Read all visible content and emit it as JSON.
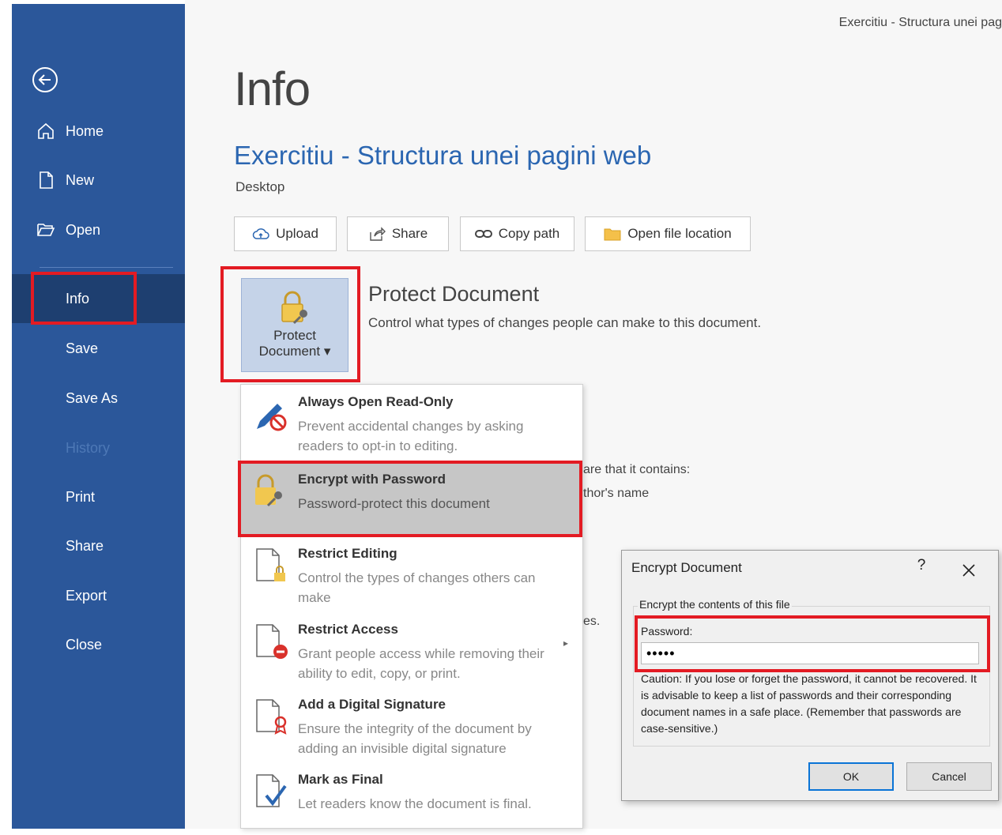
{
  "sidebar": {
    "items": [
      {
        "label": "Home"
      },
      {
        "label": "New"
      },
      {
        "label": "Open"
      },
      {
        "label": "Info"
      },
      {
        "label": "Save"
      },
      {
        "label": "Save As"
      },
      {
        "label": "History"
      },
      {
        "label": "Print"
      },
      {
        "label": "Share"
      },
      {
        "label": "Export"
      },
      {
        "label": "Close"
      }
    ]
  },
  "window_title": "Exercitiu - Structura unei pag",
  "main": {
    "title": "Info",
    "doc_name": "Exercitiu - Structura unei pagini web",
    "doc_location": "Desktop",
    "buttons": [
      "Upload",
      "Share",
      "Copy path",
      "Open file location"
    ],
    "protect": {
      "tile_line1": "Protect",
      "tile_line2": "Document ▾",
      "heading": "Protect Document",
      "description": "Control what types of changes people can make to this document."
    },
    "behind_text": {
      "line1": "are that it contains:",
      "line2": "thor's name",
      "line3": "es."
    }
  },
  "protect_menu": {
    "items": [
      {
        "title": "Always Open Read-Only",
        "desc": "Prevent accidental changes by asking readers to opt-in to editing."
      },
      {
        "title": "Encrypt with Password",
        "desc": "Password-protect this document"
      },
      {
        "title": "Restrict Editing",
        "desc": "Control the types of changes others can make"
      },
      {
        "title": "Restrict Access",
        "desc": "Grant people access while removing their ability to edit, copy, or print."
      },
      {
        "title": "Add a Digital Signature",
        "desc": "Ensure the integrity of the document by adding an invisible digital signature"
      },
      {
        "title": "Mark as Final",
        "desc": "Let readers know the document is final."
      }
    ]
  },
  "dialog": {
    "title": "Encrypt Document",
    "help": "?",
    "subtitle": "Encrypt the contents of this file",
    "password_label": "Password:",
    "password_value": "•••••",
    "caution": "Caution: If you lose or forget the password, it cannot be recovered. It is advisable to keep a list of passwords and their corresponding document names in a safe place. (Remember that passwords are case-sensitive.)",
    "ok": "OK",
    "cancel": "Cancel"
  },
  "colors": {
    "sidebar": "#2b579a",
    "sidebar_active": "#1e3f70",
    "accent_title": "#2b66b1",
    "highlight_box": "#e31b23"
  }
}
